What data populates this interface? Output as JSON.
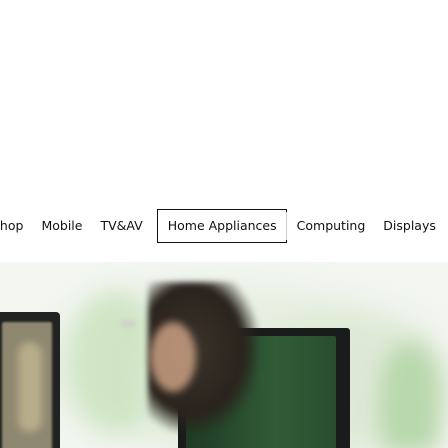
{
  "nav": {
    "items": [
      {
        "label": "Shop"
      },
      {
        "label": "Mobile"
      },
      {
        "label": "TV&AV"
      },
      {
        "label": "Home Appliances"
      },
      {
        "label": "Computing"
      },
      {
        "label": "Displays"
      }
    ],
    "selected": "Home Appliances"
  },
  "colors": {
    "text": "#111111",
    "selected_border": "#111111",
    "divider": "#cccccc"
  },
  "banner": {
    "image": "tv-lifestyle-banner"
  }
}
